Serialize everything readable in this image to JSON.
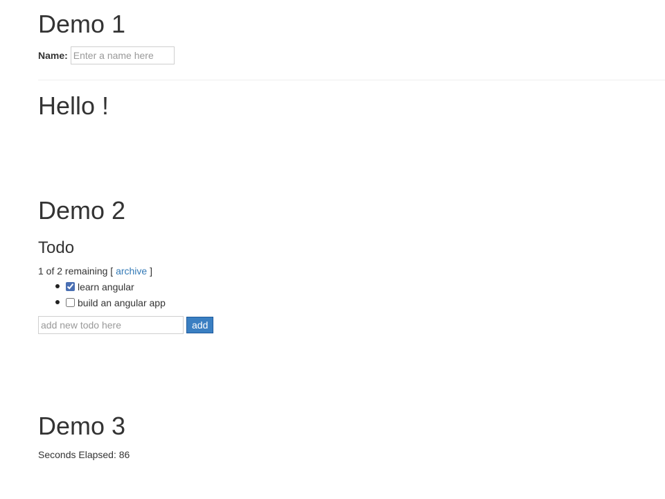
{
  "demo1": {
    "title": "Demo 1",
    "name_label": "Name:",
    "name_value": "",
    "name_placeholder": "Enter a name here",
    "greeting": "Hello !"
  },
  "demo2": {
    "title": "Demo 2",
    "todo_heading": "Todo",
    "remaining_text": "1 of 2 remaining [ ",
    "archive_label": "archive",
    "remaining_suffix": " ]",
    "items": [
      {
        "text": "learn angular",
        "done": true
      },
      {
        "text": "build an angular app",
        "done": false
      }
    ],
    "new_todo_placeholder": "add new todo here",
    "add_label": "add"
  },
  "demo3": {
    "title": "Demo 3",
    "seconds_label": "Seconds Elapsed: ",
    "seconds_value": "86"
  },
  "colors": {
    "text": "#333333",
    "link": "#337ab7",
    "button": "#3a7fc2"
  }
}
